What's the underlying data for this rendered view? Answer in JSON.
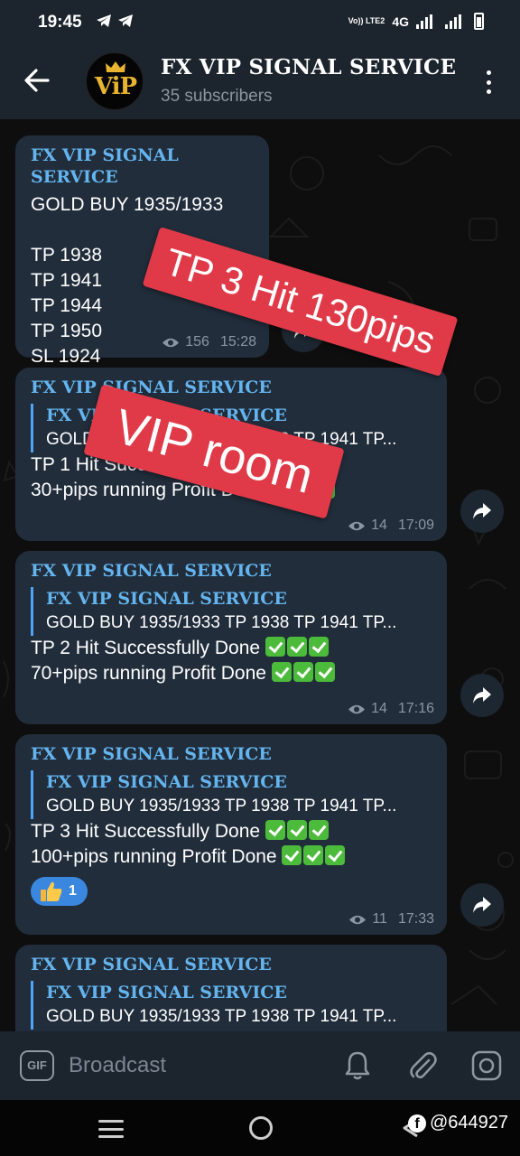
{
  "status_bar": {
    "time": "19:45",
    "network_label": "Vo)) LTE2",
    "network_type": "4G",
    "app_icons": [
      "telegram-icon",
      "telegram-icon"
    ]
  },
  "header": {
    "avatar_text": "ViP",
    "title": "FX VIP SIGNAL SERVICE",
    "subtitle": "35 subscribers"
  },
  "messages": [
    {
      "sender": "FX VIP SIGNAL SERVICE",
      "lines": [
        "GOLD BUY 1935/1933",
        "",
        "TP 1938",
        "TP 1941",
        "TP 1944",
        "TP 1950",
        "SL 1924"
      ],
      "views": "156",
      "time": "15:28"
    },
    {
      "sender": "FX VIP SIGNAL SERVICE",
      "reply_title": "FX VIP SIGNAL SERVICE",
      "reply_text": "GOLD BUY 1935/1933  TP 1938 TP 1941 TP...",
      "line1": "TP 1 Hit Successfully Done",
      "line2": "30+pips running Profit Done",
      "views": "14",
      "time": "17:09"
    },
    {
      "sender": "FX VIP SIGNAL SERVICE",
      "reply_title": "FX VIP SIGNAL SERVICE",
      "reply_text": "GOLD BUY 1935/1933  TP 1938 TP 1941 TP...",
      "line1": "TP 2 Hit Successfully Done",
      "line2": "70+pips running Profit Done",
      "views": "14",
      "time": "17:16"
    },
    {
      "sender": "FX VIP SIGNAL SERVICE",
      "reply_title": "FX VIP SIGNAL SERVICE",
      "reply_text": "GOLD BUY 1935/1933  TP 1938 TP 1941 TP...",
      "line1": "TP 3 Hit Successfully Done",
      "line2": "100+pips running Profit Done",
      "reaction_count": "1",
      "views": "11",
      "time": "17:33"
    },
    {
      "sender": "FX VIP SIGNAL SERVICE",
      "reply_title": "FX VIP SIGNAL SERVICE",
      "reply_text": "GOLD BUY 1935/1933  TP 1938 TP 1941 TP..."
    }
  ],
  "overlays": {
    "stamp1": "TP  3 Hit 130pips",
    "stamp2": "VIP room"
  },
  "input_bar": {
    "gif_label": "GIF",
    "placeholder": "Broadcast"
  },
  "watermark": "@644927",
  "colors": {
    "header_bg": "#1c242d",
    "bubble_bg": "#212d3b",
    "sender": "#64b5ef",
    "stamp": "#e03a48",
    "check": "#4cba3a",
    "reaction": "#3a87df"
  }
}
